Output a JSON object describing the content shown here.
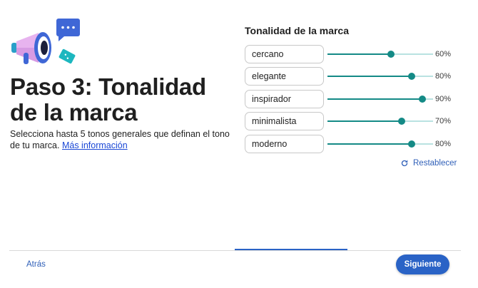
{
  "header": {
    "step_title": "Paso 3: Tonalidad de la marca",
    "description": "Selecciona hasta 5 tonos generales que definan el tono de tu marca.",
    "more_info_link": "Más información"
  },
  "tones": {
    "title": "Tonalidad de la marca",
    "items": [
      {
        "label": "cercano",
        "value": 60,
        "value_text": "60%"
      },
      {
        "label": "elegante",
        "value": 80,
        "value_text": "80%"
      },
      {
        "label": "inspirador",
        "value": 90,
        "value_text": "90%"
      },
      {
        "label": "minimalista",
        "value": 70,
        "value_text": "70%"
      },
      {
        "label": "moderno",
        "value": 80,
        "value_text": "80%"
      }
    ],
    "reset_label": "Restablecer",
    "reset_icon": "refresh-icon"
  },
  "footer": {
    "back_label": "Atrás",
    "next_label": "Siguiente"
  },
  "colors": {
    "accent_blue": "#2a63c6",
    "slider_teal": "#148a86",
    "slider_track": "#b9e2e1",
    "link_blue": "#1a47d6"
  },
  "icons": [
    "megaphone-icon",
    "chat-bubble-icon",
    "ticket-icon",
    "refresh-icon"
  ]
}
